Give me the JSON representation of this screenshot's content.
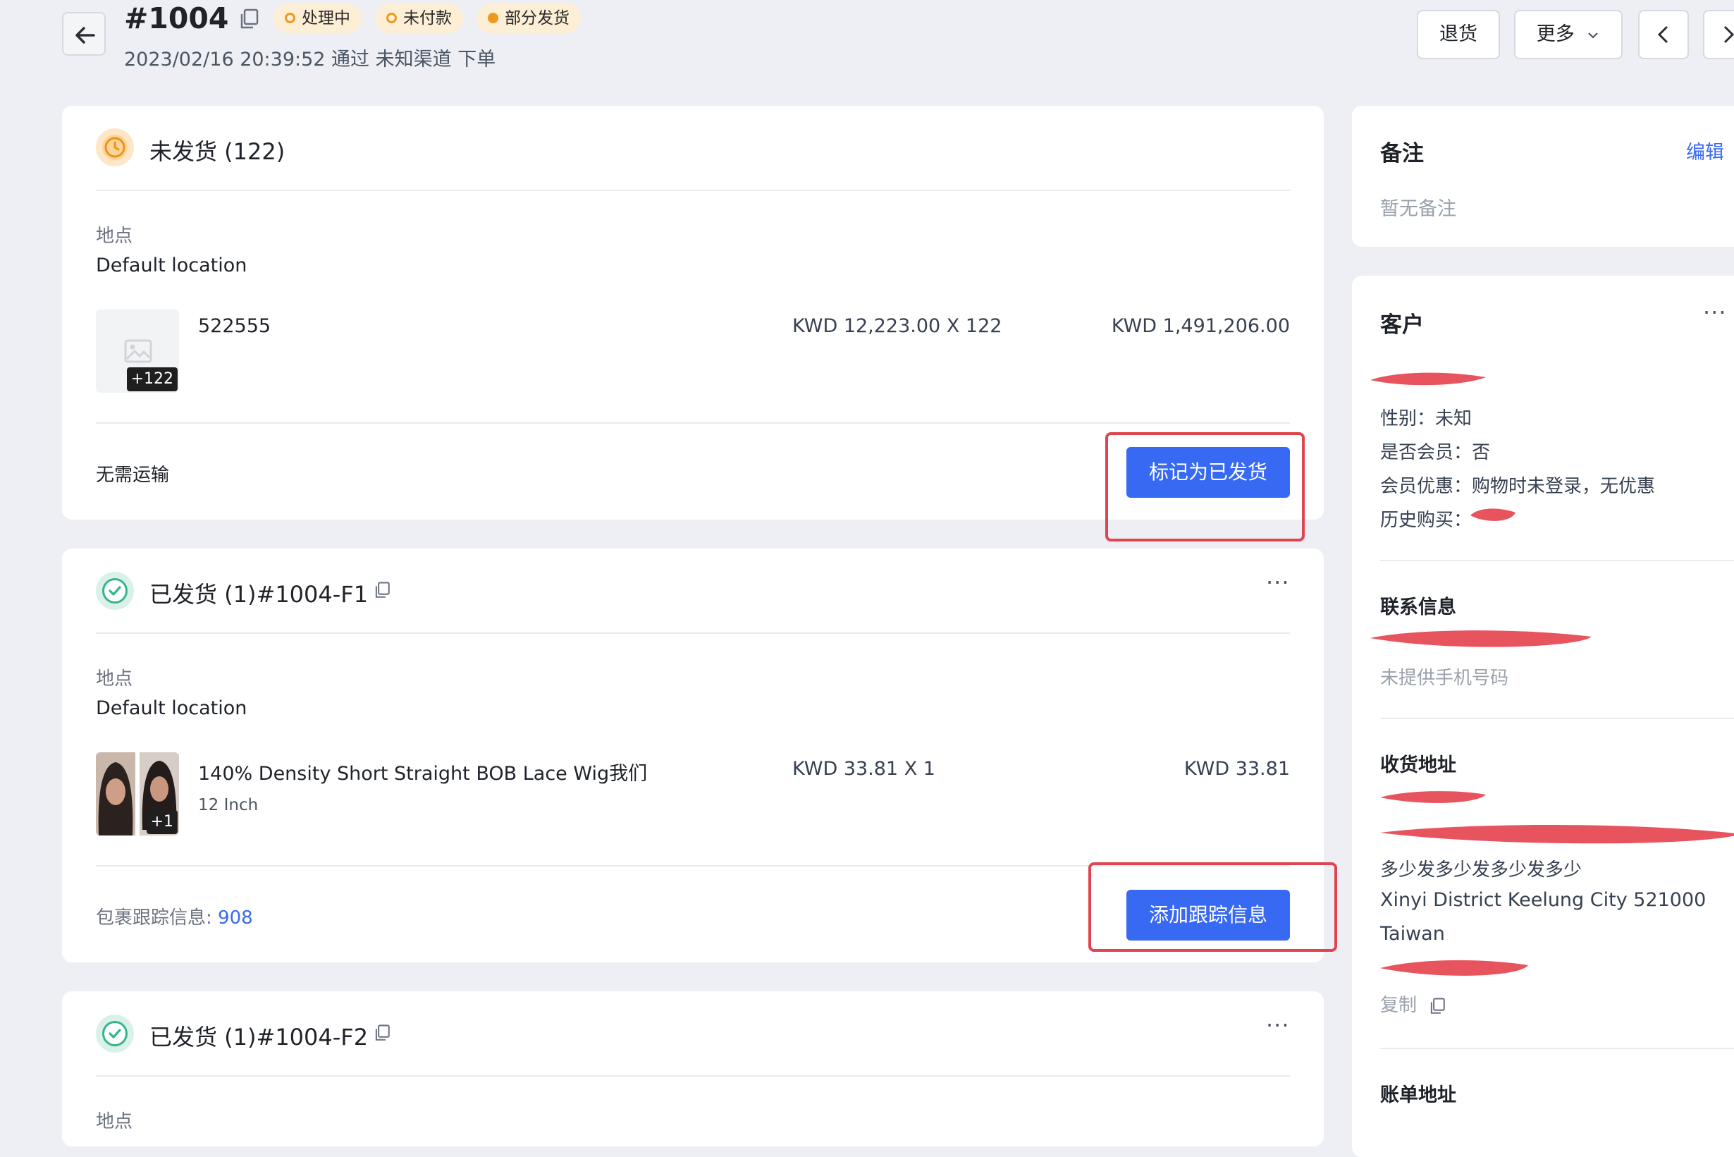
{
  "header": {
    "order_id": "#1004",
    "tags": [
      "处理中",
      "未付款",
      "部分发货"
    ],
    "subline": "2023/02/16 20:39:52 通过 未知渠道 下单",
    "return_button": "退货",
    "more_button": "更多"
  },
  "unfulfilled": {
    "title": "未发货 (122)",
    "location_label": "地点",
    "location_value": "Default location",
    "item": {
      "name": "522555",
      "unit_price": "KWD 12,223.00 X 122",
      "total": "KWD 1,491,206.00",
      "badge": "+122"
    },
    "shipping_text": "无需运输",
    "action_button": "标记为已发货"
  },
  "fulfillment_1": {
    "title": "已发货 (1)#1004-F1",
    "location_label": "地点",
    "location_value": "Default location",
    "item": {
      "name": "140% Density Short Straight BOB Lace Wig我们",
      "variant": "12 Inch",
      "unit_price": "KWD 33.81 X 1",
      "total": "KWD 33.81",
      "badge": "+1"
    },
    "tracking_label": "包裹跟踪信息:",
    "tracking_value": "908",
    "action_button": "添加跟踪信息"
  },
  "fulfillment_2": {
    "title": "已发货 (1)#1004-F2",
    "location_label": "地点"
  },
  "notes": {
    "title": "备注",
    "edit_link": "编辑",
    "empty_text": "暂无备注"
  },
  "customer": {
    "title": "客户",
    "gender": "性别：未知",
    "member": "是否会员：否",
    "discount": "会员优惠：购物时未登录，无优惠",
    "history_label": "历史购买："
  },
  "contact": {
    "title": "联系信息",
    "phone_placeholder": "未提供手机号码"
  },
  "shipping_address": {
    "title": "收货地址",
    "line3": "多少发多少发多少发多少",
    "line4": "Xinyi District Keelung City 521000",
    "country": "Taiwan",
    "copy_label": "复制"
  },
  "billing_address": {
    "title": "账单地址"
  },
  "colors": {
    "primary": "#3769f3",
    "warning": "#ec9a1c",
    "success": "#35b58a",
    "highlight_frame": "#e0454f",
    "redaction": "#e8545e"
  },
  "icons": [
    "arrow-left-icon",
    "copy-icon",
    "chevron-down-icon",
    "chevron-left-icon",
    "chevron-right-icon",
    "clock-icon",
    "check-circle-icon",
    "image-placeholder-icon",
    "more-icon"
  ]
}
